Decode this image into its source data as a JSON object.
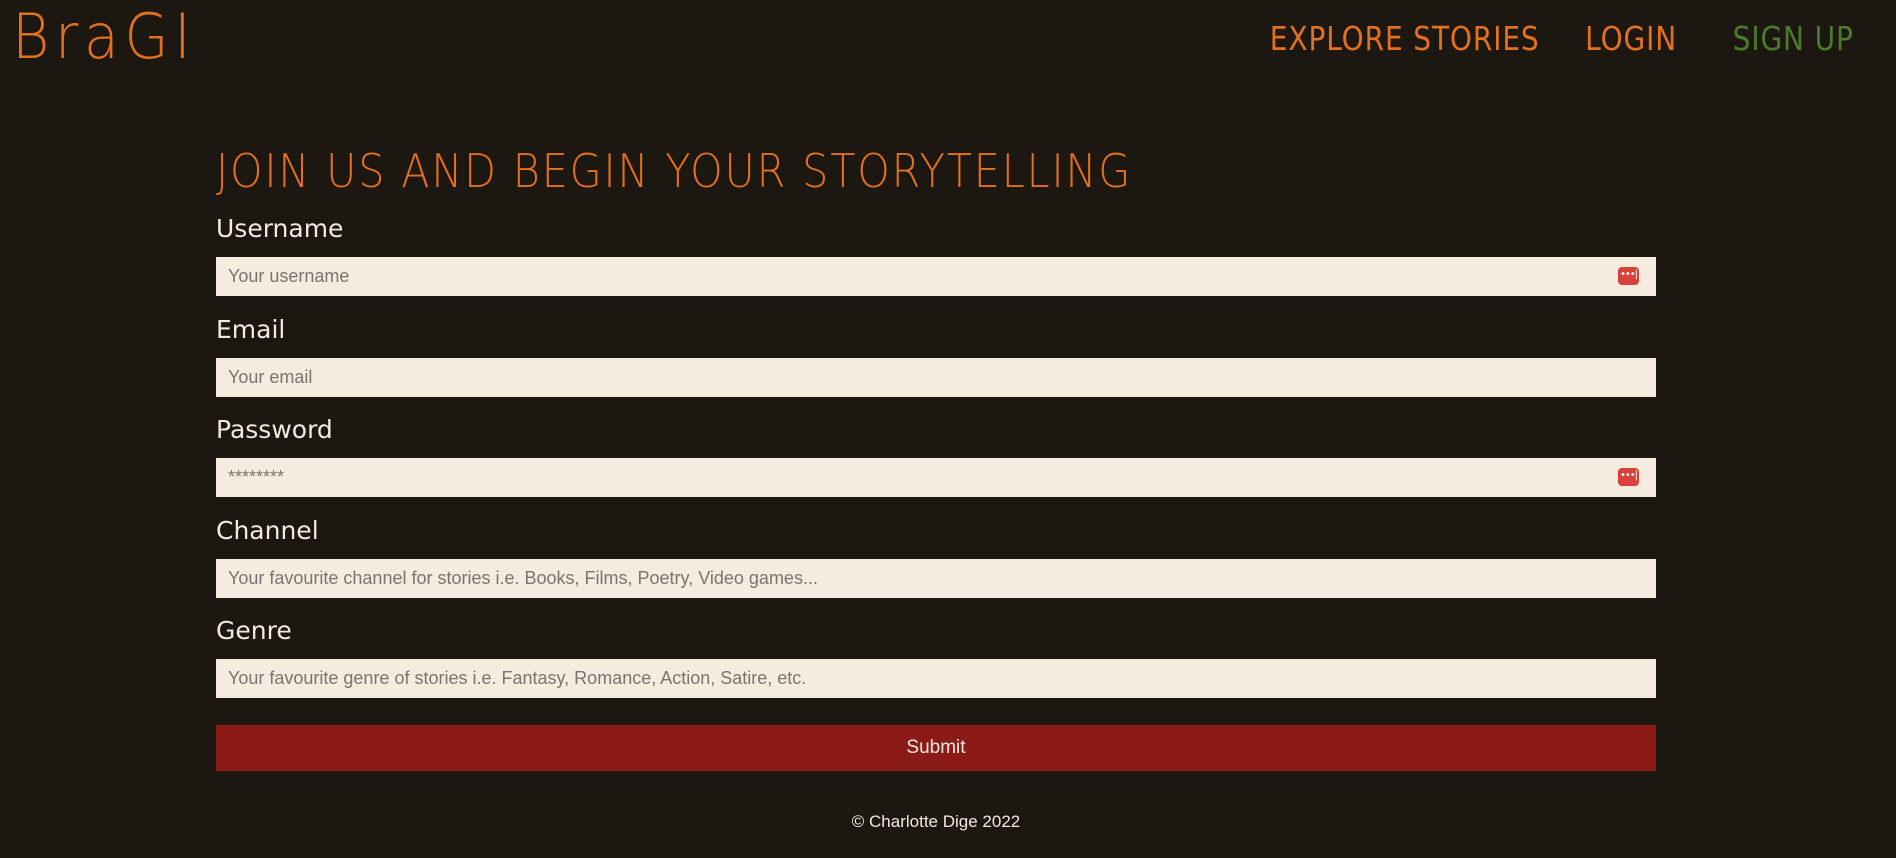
{
  "brand": {
    "logo_text": "BraGI"
  },
  "nav": {
    "explore": "EXPLORE STORIES",
    "login": "LOGIN",
    "signup": "SIGN UP"
  },
  "page": {
    "title": "JOIN US AND BEGIN YOUR STORYTELLING"
  },
  "form": {
    "username": {
      "label": "Username",
      "placeholder": "Your username"
    },
    "email": {
      "label": "Email",
      "placeholder": "Your email"
    },
    "password": {
      "label": "Password",
      "placeholder": "********"
    },
    "channel": {
      "label": "Channel",
      "placeholder": "Your favourite channel for stories i.e. Books, Films, Poetry, Video games..."
    },
    "genre": {
      "label": "Genre",
      "placeholder": "Your favourite genre of stories i.e. Fantasy, Romance, Action, Satire, etc."
    },
    "submit_label": "Submit",
    "password_manager_icon": "dots-icon"
  },
  "footer": {
    "copyright": "© Charlotte Dige 2022"
  },
  "colors": {
    "background": "#1c1811",
    "accent": "#e2701f",
    "signup": "#4c7a2c",
    "input_bg": "#f5ebdf",
    "button": "#8c1b18"
  }
}
